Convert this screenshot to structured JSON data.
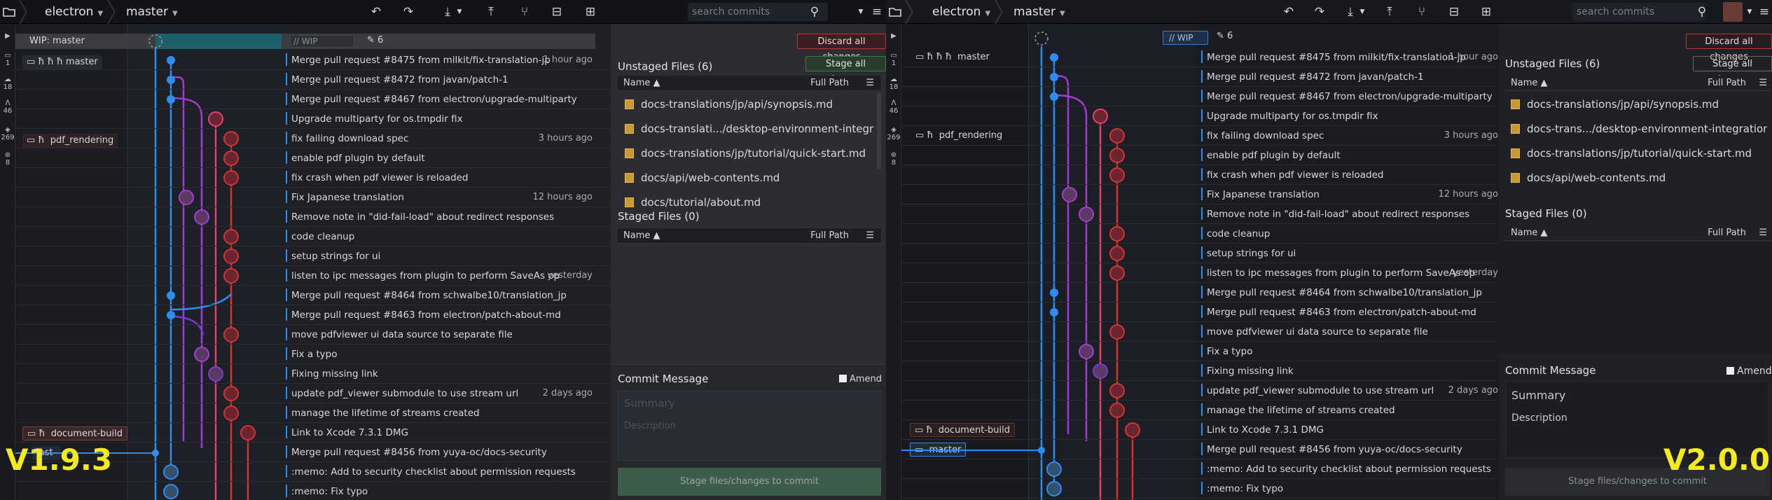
{
  "left": {
    "repo": "electron",
    "branch": "master",
    "search_placeholder": "search commits",
    "rail": [
      {
        "label": "1"
      },
      {
        "label": "18"
      },
      {
        "label": "46"
      },
      {
        "label": "269"
      },
      {
        "label": "8"
      }
    ],
    "wip_label": "WIP: master",
    "wip_input": "// WIP",
    "wip_count": "6",
    "refs": {
      "master": "master",
      "pdf": "pdf_rendering",
      "docbuild": "document-build",
      "last": "last"
    },
    "commits": [
      {
        "msg": "Merge pull request #8475 from milkit/fix-translation-jp",
        "time": "1 hour ago"
      },
      {
        "msg": "Merge pull request #8472 from javan/patch-1",
        "time": ""
      },
      {
        "msg": "Merge pull request #8467 from electron/upgrade-multiparty",
        "time": ""
      },
      {
        "msg": "Upgrade multiparty for os.tmpdir fix",
        "time": ""
      },
      {
        "msg": "fix failing download spec",
        "time": "3 hours ago"
      },
      {
        "msg": "enable pdf plugin by default",
        "time": ""
      },
      {
        "msg": "fix crash when pdf viewer is reloaded",
        "time": ""
      },
      {
        "msg": "Fix Japanese translation",
        "time": "12 hours ago"
      },
      {
        "msg": "Remove note in \"did-fail-load\" about redirect responses",
        "time": ""
      },
      {
        "msg": "code cleanup",
        "time": ""
      },
      {
        "msg": "setup strings for ui",
        "time": ""
      },
      {
        "msg": "listen to ipc messages from plugin to perform SaveAs op",
        "time": "yesterday"
      },
      {
        "msg": "Merge pull request #8464 from schwalbe10/translation_jp",
        "time": ""
      },
      {
        "msg": "Merge pull request #8463 from electron/patch-about-md",
        "time": ""
      },
      {
        "msg": "move pdfviewer ui data source to separate file",
        "time": ""
      },
      {
        "msg": "Fix a typo",
        "time": ""
      },
      {
        "msg": "Fixing missing link",
        "time": ""
      },
      {
        "msg": "update pdf_viewer submodule to use stream url",
        "time": "2 days ago"
      },
      {
        "msg": "manage the lifetime of streams created",
        "time": ""
      },
      {
        "msg": "Link to Xcode 7.3.1 DMG",
        "time": ""
      },
      {
        "msg": "Merge pull request #8456 from yuya-oc/docs-security",
        "time": ""
      },
      {
        "msg": ":memo: Add to security checklist about permission requests",
        "time": ""
      },
      {
        "msg": ":memo: Fix typo",
        "time": ""
      }
    ],
    "panel": {
      "discard": "Discard all changes",
      "stage_all": "Stage all changes",
      "unstaged": "Unstaged Files (6)",
      "staged": "Staged Files (0)",
      "name_col": "Name",
      "fullpath": "Full Path",
      "files": [
        "docs-translations/jp/api/synopsis.md",
        "docs-translati.../desktop-environment-integration.md",
        "docs-translations/jp/tutorial/quick-start.md",
        "docs/api/web-contents.md",
        "docs/tutorial/about.md"
      ],
      "commit_msg": "Commit Message",
      "amend": "Amend",
      "summary": "Summary",
      "description": "Description",
      "stage_btn": "Stage files/changes to commit"
    },
    "version": "V1.9.3"
  },
  "right": {
    "repo": "electron",
    "branch": "master",
    "search_placeholder": "search commits",
    "rail": [
      {
        "label": "1"
      },
      {
        "label": "18"
      },
      {
        "label": "46"
      },
      {
        "label": "269"
      },
      {
        "label": "8"
      }
    ],
    "wip_input": "// WIP",
    "wip_count": "6",
    "refs": {
      "master": "master",
      "pdf": "pdf_rendering",
      "docbuild": "document-build",
      "master2": "master"
    },
    "commits": [
      {
        "msg": "Merge pull request #8475 from milkit/fix-translation-jp",
        "time": "1 hour ago"
      },
      {
        "msg": "Merge pull request #8472 from javan/patch-1",
        "time": ""
      },
      {
        "msg": "Merge pull request #8467 from electron/upgrade-multiparty",
        "time": ""
      },
      {
        "msg": "Upgrade multiparty for os.tmpdir fix",
        "time": ""
      },
      {
        "msg": "fix failing download spec",
        "time": "3 hours ago"
      },
      {
        "msg": "enable pdf plugin by default",
        "time": ""
      },
      {
        "msg": "fix crash when pdf viewer is reloaded",
        "time": ""
      },
      {
        "msg": "Fix Japanese translation",
        "time": "12 hours ago"
      },
      {
        "msg": "Remove note in \"did-fail-load\" about redirect responses",
        "time": ""
      },
      {
        "msg": "code cleanup",
        "time": ""
      },
      {
        "msg": "setup strings for ui",
        "time": ""
      },
      {
        "msg": "listen to ipc messages from plugin to perform SaveAs op",
        "time": "yesterday"
      },
      {
        "msg": "Merge pull request #8464 from schwalbe10/translation_jp",
        "time": ""
      },
      {
        "msg": "Merge pull request #8463 from electron/patch-about-md",
        "time": ""
      },
      {
        "msg": "move pdfviewer ui data source to separate file",
        "time": ""
      },
      {
        "msg": "Fix a typo",
        "time": ""
      },
      {
        "msg": "Fixing missing link",
        "time": ""
      },
      {
        "msg": "update pdf_viewer submodule to use stream url",
        "time": "2 days ago"
      },
      {
        "msg": "manage the lifetime of streams created",
        "time": ""
      },
      {
        "msg": "Link to Xcode 7.3.1 DMG",
        "time": ""
      },
      {
        "msg": "Merge pull request #8456 from yuya-oc/docs-security",
        "time": ""
      },
      {
        "msg": ":memo: Add to security checklist about permission requests",
        "time": ""
      },
      {
        "msg": ":memo: Fix typo",
        "time": ""
      }
    ],
    "panel": {
      "discard": "Discard all changes",
      "stage_all": "Stage all changes",
      "unstaged": "Unstaged Files (6)",
      "staged": "Staged Files (0)",
      "name_col": "Name",
      "fullpath": "Full Path",
      "files": [
        "docs-translations/jp/api/synopsis.md",
        "docs-trans.../desktop-environment-integration.md",
        "docs-translations/jp/tutorial/quick-start.md",
        "docs/api/web-contents.md"
      ],
      "commit_msg": "Commit Message",
      "amend": "Amend",
      "summary": "Summary",
      "description": "Description",
      "stage_btn": "Stage files/changes to commit"
    },
    "version": "V2.0.0"
  },
  "colors": {
    "blue": "#2f8cf0",
    "purple": "#a63bd3",
    "pink": "#e0436f",
    "red": "#d2352f",
    "violet": "#7a3ad1",
    "yellow": "#f3ea21"
  }
}
